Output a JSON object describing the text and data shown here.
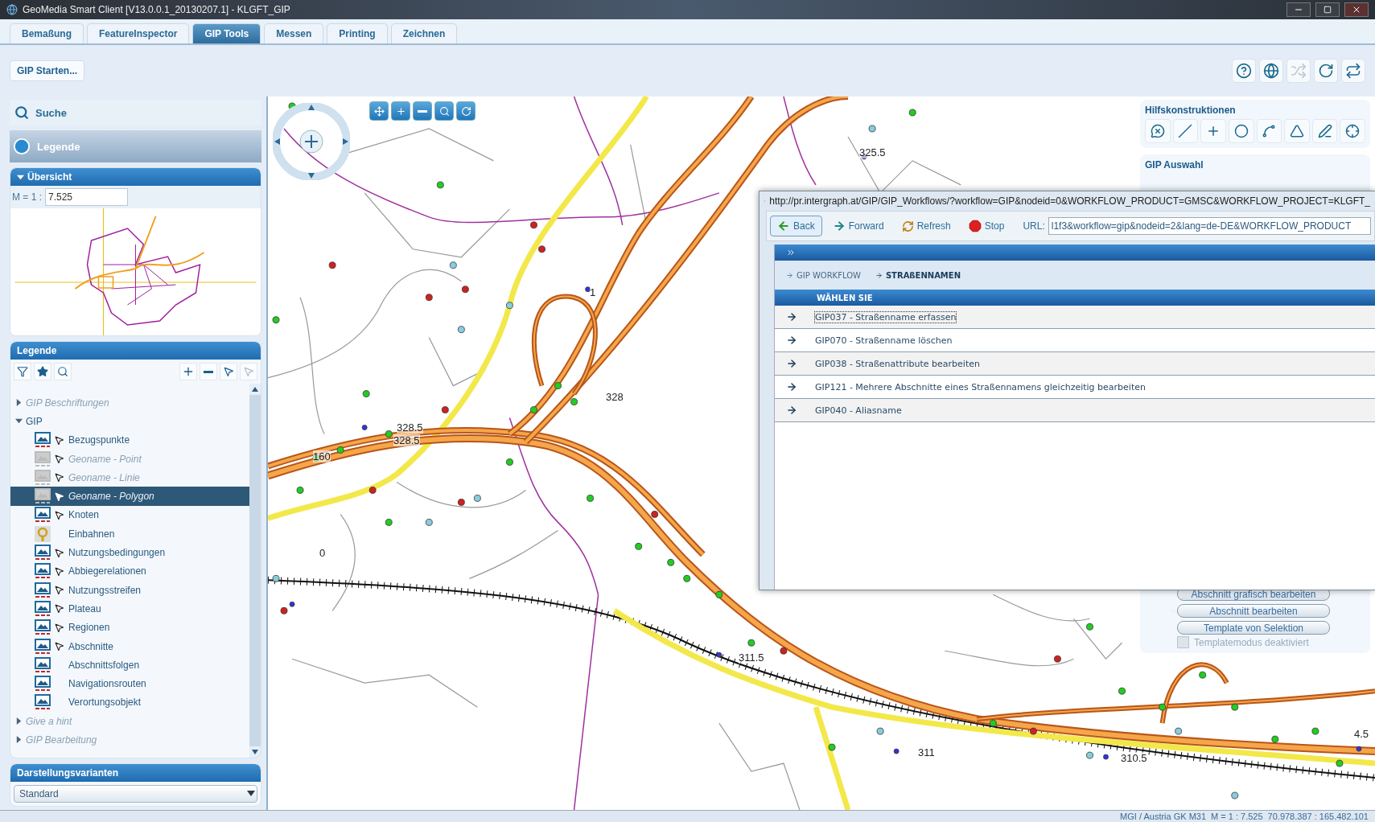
{
  "window": {
    "title": "GeoMedia Smart Client  [V13.0.0.1_20130207.1] - KLGFT_GIP"
  },
  "tabs": [
    {
      "label": "Bemaßung",
      "selected": false
    },
    {
      "label": "FeatureInspector",
      "selected": false
    },
    {
      "label": "GIP Tools",
      "selected": true
    },
    {
      "label": "Messen",
      "selected": false
    },
    {
      "label": "Printing",
      "selected": false
    },
    {
      "label": "Zeichnen",
      "selected": false
    }
  ],
  "toolbar": {
    "start_button": "GIP Starten..."
  },
  "sidebar": {
    "search": "Suche",
    "legend_button": {
      "label": "Legende",
      "selected": true
    },
    "overview": {
      "title": "Übersicht",
      "expanded": true,
      "scale_label": "M = 1 :",
      "scale_value": "7.525"
    },
    "legend": {
      "title": "Legende",
      "tree": [
        {
          "kind": "group",
          "label": "GIP Beschriftungen",
          "expanded": false,
          "disabled": true
        },
        {
          "kind": "group",
          "label": "GIP",
          "expanded": true,
          "disabled": false,
          "children": [
            {
              "kind": "layer",
              "label": "Bezugspunkte",
              "selectable": true,
              "disabled": false,
              "selected": false
            },
            {
              "kind": "layer",
              "label": "Geoname - Point",
              "selectable": true,
              "disabled": true,
              "selected": false
            },
            {
              "kind": "layer",
              "label": "Geoname - Linie",
              "selectable": true,
              "disabled": true,
              "selected": false
            },
            {
              "kind": "layer",
              "label": "Geoname - Polygon",
              "selectable": true,
              "disabled": true,
              "selected": true
            },
            {
              "kind": "layer",
              "label": "Knoten",
              "selectable": true,
              "disabled": false,
              "selected": false
            },
            {
              "kind": "query",
              "label": "Einbahnen",
              "selectable": false,
              "disabled": false,
              "selected": false
            },
            {
              "kind": "layer",
              "label": "Nutzungsbedingungen",
              "selectable": true,
              "disabled": false,
              "selected": false
            },
            {
              "kind": "layer",
              "label": "Abbiegerelationen",
              "selectable": true,
              "disabled": false,
              "selected": false
            },
            {
              "kind": "layer",
              "label": "Nutzungsstreifen",
              "selectable": true,
              "disabled": false,
              "selected": false
            },
            {
              "kind": "layer",
              "label": "Plateau",
              "selectable": true,
              "disabled": false,
              "selected": false
            },
            {
              "kind": "layer",
              "label": "Regionen",
              "selectable": true,
              "disabled": false,
              "selected": false
            },
            {
              "kind": "layer",
              "label": "Abschnitte",
              "selectable": true,
              "disabled": false,
              "selected": false
            },
            {
              "kind": "layer",
              "label": "Abschnittsfolgen",
              "selectable": false,
              "disabled": false,
              "selected": false
            },
            {
              "kind": "layer",
              "label": "Navigationsrouten",
              "selectable": false,
              "disabled": false,
              "selected": false
            },
            {
              "kind": "layer",
              "label": "Verortungsobjekt",
              "selectable": false,
              "disabled": false,
              "selected": false
            }
          ]
        },
        {
          "kind": "group",
          "label": "Give a hint",
          "expanded": false,
          "disabled": true
        },
        {
          "kind": "group",
          "label": "GIP Bearbeitung",
          "expanded": false,
          "disabled": true
        }
      ]
    },
    "display_variants": {
      "title": "Darstellungsvarianten",
      "value": "Standard"
    }
  },
  "map": {
    "labels": [
      "325.5",
      "1",
      "328",
      "328.5",
      "328.5",
      "160",
      "0",
      "311.5",
      "311",
      "310.5",
      "4.5"
    ],
    "tools_panel": {
      "title": "Hilfskonstruktionen"
    },
    "selection_panel": {
      "title": "GIP Auswahl",
      "buttons": [
        "Abschnitt grafisch bearbeiten",
        "Abschnitt bearbeiten",
        "Template von Selektion"
      ],
      "template_mode": {
        "label": "Templatemodus deaktiviert",
        "checked": false
      }
    }
  },
  "browser": {
    "title": "http://pr.intergraph.at/GIP/GIP_Workflows/?workflow=GIP&nodeid=0&WORKFLOW_PRODUCT=GMSC&WORKFLOW_PROJECT=KLGFT_",
    "nav": [
      {
        "kind": "back",
        "label": "Back",
        "selected": true
      },
      {
        "kind": "forward",
        "label": "Forward",
        "selected": false
      },
      {
        "kind": "refresh",
        "label": "Refresh",
        "selected": false
      },
      {
        "kind": "stop",
        "label": "Stop",
        "selected": false
      }
    ],
    "url_label": "URL:",
    "url_value": "l1f3&workflow=gip&nodeid=2&lang=de-DE&WORKFLOW_PRODUCT",
    "breadcrumbs": [
      {
        "label": "GIP WORKFLOW",
        "current": false
      },
      {
        "label": "STRAßENNAMEN",
        "current": true
      }
    ],
    "list_header": "WÄHLEN SIE",
    "items": [
      {
        "label": "GIP037 - Straßenname erfassen",
        "focused": true
      },
      {
        "label": "GIP070 - Straßenname löschen",
        "focused": false
      },
      {
        "label": "GIP038 - Straßenattribute bearbeiten",
        "focused": false
      },
      {
        "label": "GIP121 - Mehrere Abschnitte eines Straßennamens gleichzeitig bearbeiten",
        "focused": false
      },
      {
        "label": "GIP040 - Aliasname",
        "focused": false
      }
    ]
  },
  "status_bar": {
    "crs": "MGI / Austria GK M31",
    "scale": "M = 1 : 7.525",
    "coordinates": "70.978.387 : 165.482.101"
  }
}
